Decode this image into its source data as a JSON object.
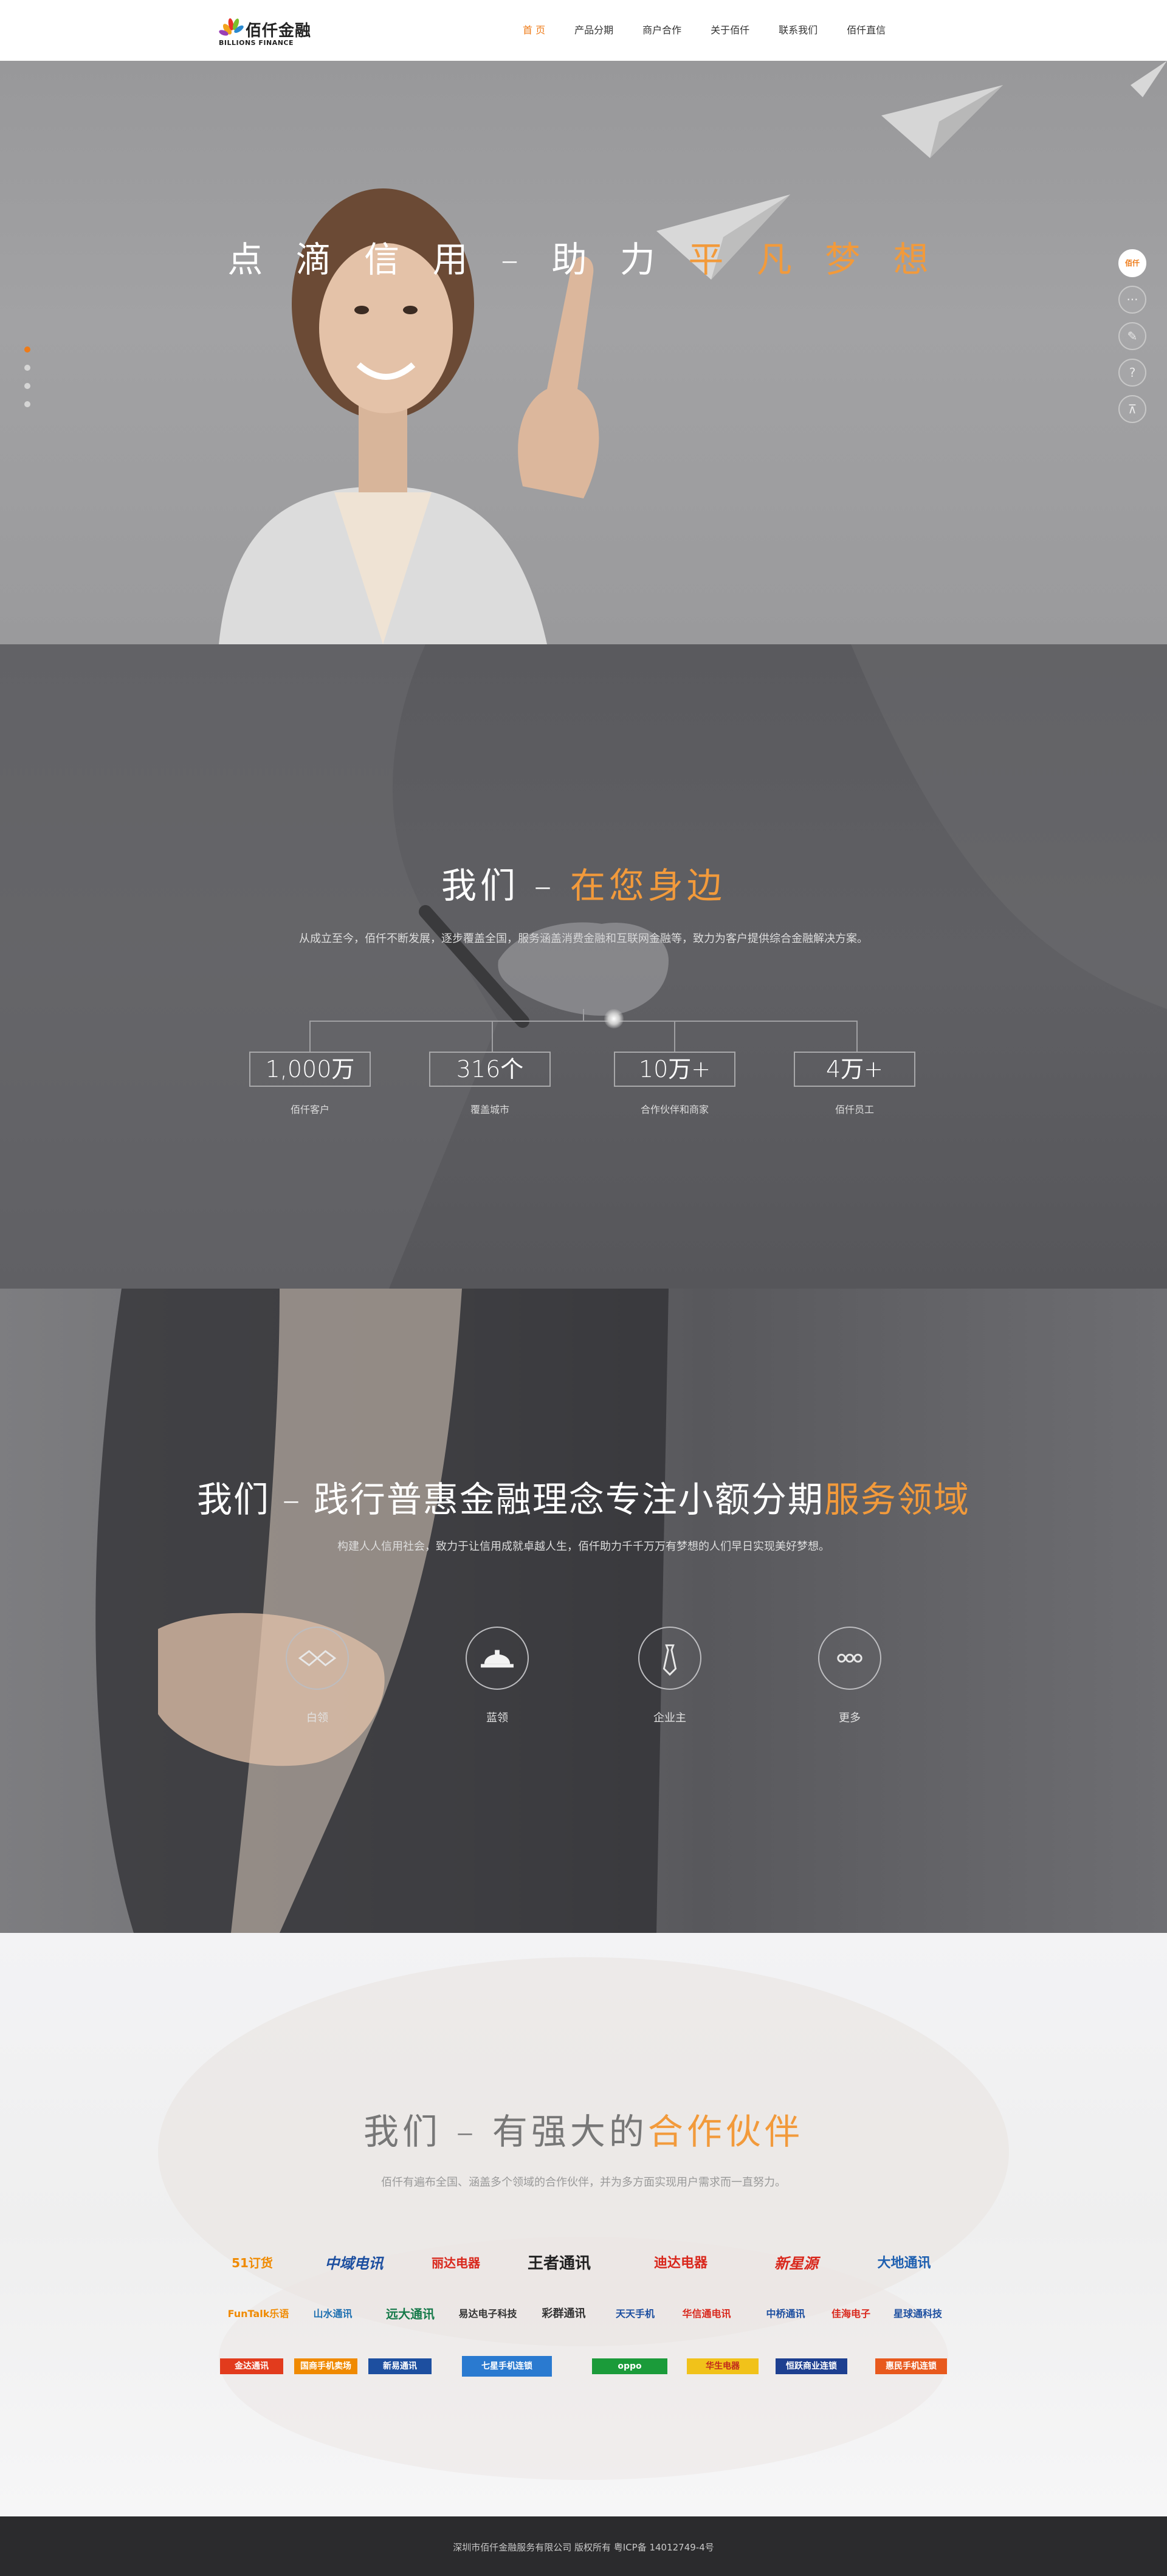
{
  "header": {
    "logo": {
      "cn": "佰仟金融",
      "en": "BILLIONS FINANCE"
    },
    "nav": [
      {
        "label": "首 页",
        "active": true
      },
      {
        "label": "产品分期",
        "active": false
      },
      {
        "label": "商户合作",
        "active": false
      },
      {
        "label": "关于佰仟",
        "active": false
      },
      {
        "label": "联系我们",
        "active": false
      },
      {
        "label": "佰仟直信",
        "active": false
      }
    ]
  },
  "hero": {
    "title_main": "点 滴 信 用 – 助 力 ",
    "title_highlight": "平 凡 梦 想",
    "slides": 4,
    "active_slide": 1
  },
  "side_tools": {
    "brand_label": "佰仟",
    "items": [
      {
        "icon": "chat-icon",
        "glyph": "···"
      },
      {
        "icon": "edit-icon",
        "glyph": "✎"
      },
      {
        "icon": "help-icon",
        "glyph": "?"
      },
      {
        "icon": "back-to-top-icon",
        "glyph": "⊼"
      }
    ]
  },
  "about": {
    "title_main": "我们 – ",
    "title_highlight": "在您身边",
    "subtitle": "从成立至今，佰仟不断发展，逐步覆盖全国，服务涵盖消费金融和互联网金融等，致力为客户提供综合金融解决方案。",
    "stats": [
      {
        "value": "1,000万",
        "label": "佰仟客户"
      },
      {
        "value": "316个",
        "label": "覆盖城市"
      },
      {
        "value": "10万+",
        "label": "合作伙伴和商家"
      },
      {
        "value": "4万+",
        "label": "佰仟员工"
      }
    ]
  },
  "service": {
    "title_main": "我们 – 践行普惠金融理念专注小额分期",
    "title_highlight": "服务领域",
    "subtitle": "构建人人信用社会，致力于让信用成就卓越人生，佰仟助力千千万万有梦想的人们早日实现美好梦想。",
    "items": [
      {
        "label": "白领",
        "icon": "handshake-outline-icon"
      },
      {
        "label": "蓝领",
        "icon": "hardhat-icon"
      },
      {
        "label": "企业主",
        "icon": "tie-icon"
      },
      {
        "label": "更多",
        "icon": "more-icon"
      }
    ]
  },
  "partners": {
    "title_main": "我们 – 有强大的",
    "title_highlight": "合作伙伴",
    "subtitle": "佰仟有遍布全国、涵盖多个领域的合作伙伴，并为多方面实现用户需求而一直努力。",
    "row1": [
      {
        "name": "51订货",
        "color": "#f08a00"
      },
      {
        "name": "中域电讯",
        "color": "#1d4fa0"
      },
      {
        "name": "丽达电器",
        "color": "#d9271c"
      },
      {
        "name": "王者通讯",
        "color": "#222222"
      },
      {
        "name": "迪达电器",
        "color": "#d9271c"
      },
      {
        "name": "新星源",
        "color": "#d9271c"
      },
      {
        "name": "大地通讯",
        "color": "#1d5fb0"
      }
    ],
    "row2": [
      {
        "name": "FunTalk乐语",
        "color": "#f08a00"
      },
      {
        "name": "山水通讯",
        "color": "#1d6fb0"
      },
      {
        "name": "远大通讯",
        "color": "#167a4a"
      },
      {
        "name": "易达电子科技",
        "color": "#333333"
      },
      {
        "name": "彩群通讯",
        "color": "#333333"
      },
      {
        "name": "天天手机",
        "color": "#1d4fa0"
      },
      {
        "name": "华信通电讯",
        "color": "#d9271c"
      },
      {
        "name": "中桥通讯",
        "color": "#1d4fa0"
      },
      {
        "name": "佳海电子",
        "color": "#d9271c"
      },
      {
        "name": "星球通科技",
        "color": "#1d4fa0"
      }
    ],
    "row3": [
      {
        "name": "金达通讯",
        "bg": "#e23b1d"
      },
      {
        "name": "国商手机卖场",
        "bg": "#f08a00"
      },
      {
        "name": "新易通讯",
        "bg": "#1d4fa0"
      },
      {
        "name": "七星手机连锁",
        "bg": "#2a7ad0"
      },
      {
        "name": "oppo",
        "bg": "#1b9b3a"
      },
      {
        "name": "华生电器",
        "bg": "#f1c21a"
      },
      {
        "name": "恒跃商业连锁",
        "bg": "#1d3f90"
      },
      {
        "name": "惠民手机连锁",
        "bg": "#e8591d"
      }
    ]
  },
  "footer": {
    "text": "深圳市佰仟金融服务有限公司 版权所有 粤ICP备 14012749-4号"
  }
}
